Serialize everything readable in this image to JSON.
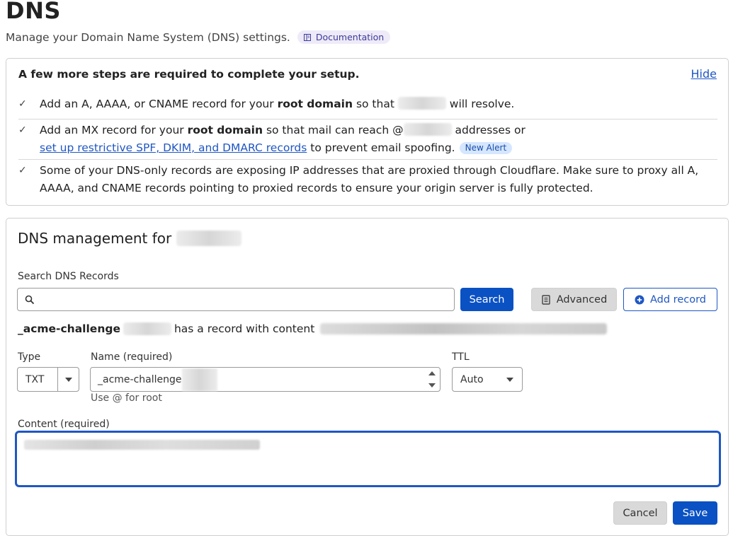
{
  "header": {
    "title": "DNS",
    "subtitle": "Manage your Domain Name System (DNS) settings.",
    "documentation_label": "Documentation"
  },
  "setup": {
    "heading": "A few more steps are required to complete your setup.",
    "hide_label": "Hide",
    "step1": {
      "pre": "Add an A, AAAA, or CNAME record for your ",
      "bold": "root domain",
      "mid": " so that ",
      "post": " will resolve."
    },
    "step2": {
      "pre": "Add an MX record for your ",
      "bold": "root domain",
      "mid": " so that mail can reach @",
      "post": " addresses or",
      "link": "set up restrictive SPF, DKIM, and DMARC records",
      "after_link": " to prevent email spoofing.",
      "badge": "New Alert"
    },
    "step3": {
      "text": "Some of your DNS-only records are exposing IP addresses that are proxied through Cloudflare. Make sure to proxy all A, AAAA, and CNAME records pointing to proxied records to ensure your origin server is fully protected."
    }
  },
  "dns": {
    "heading": "DNS management for",
    "search_label": "Search DNS Records",
    "search_value": "",
    "search_button": "Search",
    "advanced_button": "Advanced",
    "add_record_button": "Add record",
    "record_name": "_acme-challenge",
    "record_text": "has a record with content",
    "form": {
      "type_label": "Type",
      "type_value": "TXT",
      "name_label": "Name (required)",
      "name_value": "_acme-challenge",
      "name_hint": "Use @ for root",
      "ttl_label": "TTL",
      "ttl_value": "Auto",
      "content_label": "Content (required)",
      "cancel_button": "Cancel",
      "save_button": "Save"
    }
  },
  "colors": {
    "primary": "#0a51c4",
    "link": "#1f57c3",
    "badge_bg": "#d5e6ff"
  }
}
